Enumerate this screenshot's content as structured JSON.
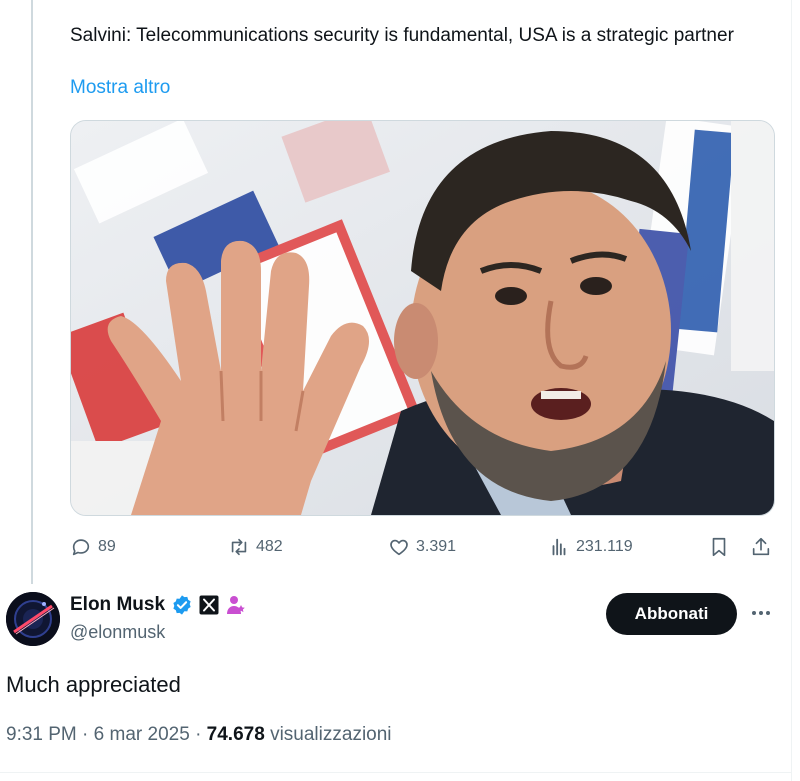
{
  "quoted": {
    "text": "Salvini: Telecommunications security is fundamental, USA is a strategic partner",
    "show_more": "Mostra altro"
  },
  "stats": {
    "replies": "89",
    "reposts": "482",
    "likes": "3.391",
    "views": "231.119"
  },
  "icons": {
    "reply": "reply-icon",
    "repost": "repost-icon",
    "like": "heart-icon",
    "views": "views-icon",
    "bookmark": "bookmark-icon",
    "share": "share-icon"
  },
  "author": {
    "name": "Elon Musk",
    "handle": "@elonmusk"
  },
  "subscribe_label": "Abbonati",
  "tweet": {
    "text": "Much appreciated",
    "time": "9:31 PM",
    "date": "6 mar 2025",
    "views_count": "74.678",
    "views_label": "visualizzazioni"
  },
  "colors": {
    "accent": "#1d9bf0",
    "text": "#0f1419",
    "muted": "#536471",
    "verified": "#1d9bf0",
    "subscribe_bg": "#0f1419"
  }
}
